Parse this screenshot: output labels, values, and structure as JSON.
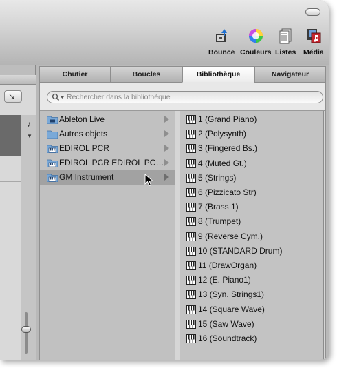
{
  "toolbar": {
    "bounce_label": "Bounce",
    "couleurs_label": "Couleurs",
    "listes_label": "Listes",
    "media_label": "Média"
  },
  "tabs": [
    {
      "label": "Chutier"
    },
    {
      "label": "Boucles"
    },
    {
      "label": "Bibliothèque"
    },
    {
      "label": "Navigateur"
    }
  ],
  "active_tab": "Bibliothèque",
  "search": {
    "placeholder": "Rechercher dans la bibliothèque"
  },
  "categories": [
    {
      "label": "Ableton Live",
      "icon": "ableton-folder-icon"
    },
    {
      "label": "Autres objets",
      "icon": "folder-icon"
    },
    {
      "label": "EDIROL PCR",
      "icon": "instrument-folder-icon"
    },
    {
      "label": "EDIROL PCR EDIROL PC…",
      "icon": "instrument-folder-icon"
    },
    {
      "label": "GM Instrument",
      "icon": "instrument-folder-icon",
      "selected": true
    }
  ],
  "patches": [
    {
      "label": "1 (Grand Piano)"
    },
    {
      "label": "2 (Polysynth)"
    },
    {
      "label": "3 (Fingered Bs.)"
    },
    {
      "label": "4 (Muted Gt.)"
    },
    {
      "label": "5 (Strings)"
    },
    {
      "label": "6 (Pizzicato Str)"
    },
    {
      "label": "7 (Brass 1)"
    },
    {
      "label": "8 (Trumpet)"
    },
    {
      "label": "9 (Reverse Cym.)"
    },
    {
      "label": "10 (STANDARD Drum)"
    },
    {
      "label": "11 (DrawOrgan)"
    },
    {
      "label": "12 (E. Piano1)"
    },
    {
      "label": "13 (Syn. Strings1)"
    },
    {
      "label": "14 (Square Wave)"
    },
    {
      "label": "15 (Saw Wave)"
    },
    {
      "label": "16 (Soundtrack)"
    }
  ],
  "left_panel": {
    "tool_glyph": "↘",
    "note_glyph": "♪"
  }
}
